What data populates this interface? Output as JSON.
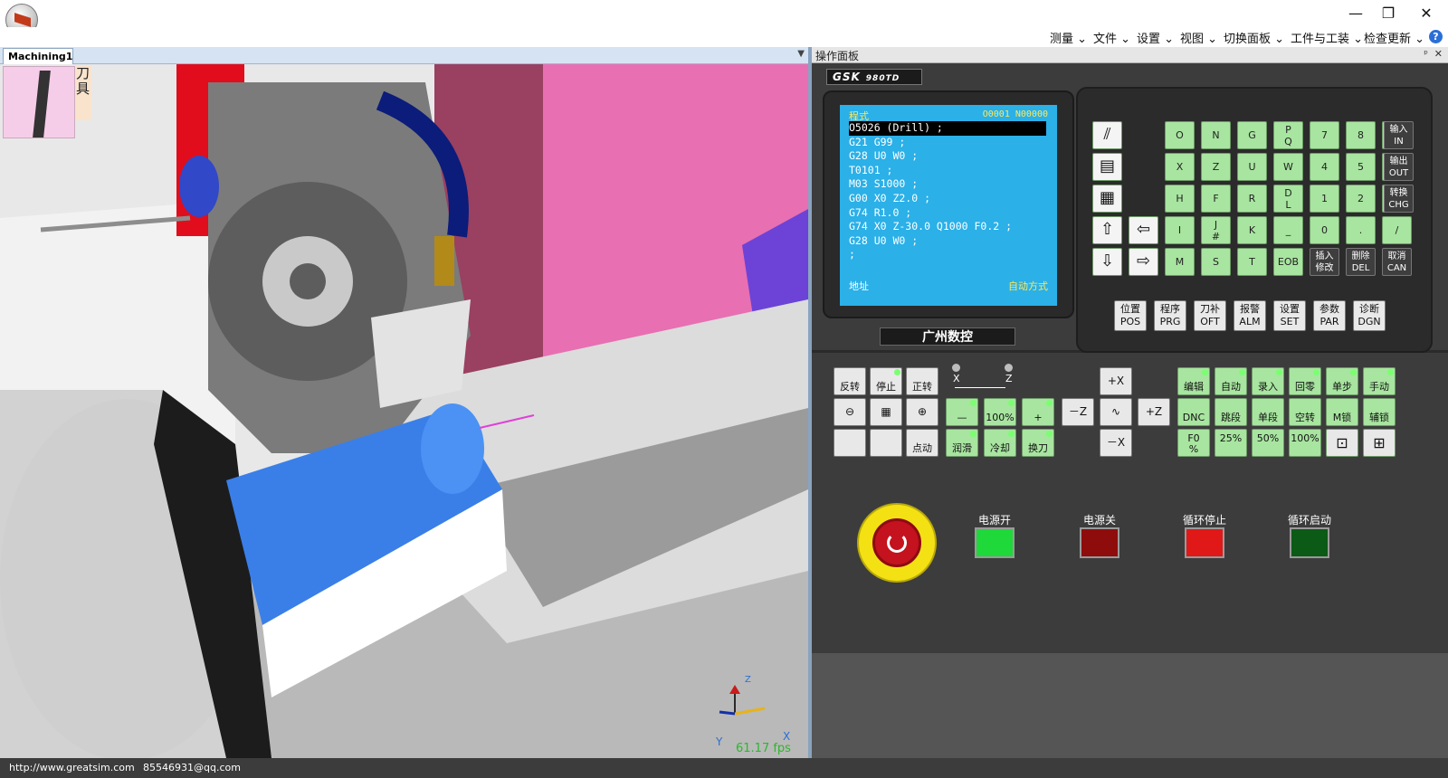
{
  "window": {
    "controls": [
      "—",
      "❐",
      "✕"
    ]
  },
  "menu": [
    "测量",
    "文件",
    "设置",
    "视图",
    "切换面板",
    "工件与工装",
    "检查更新"
  ],
  "viewport": {
    "tab": "Machining1",
    "tool_label": "刀具",
    "fps": "61.17 fps",
    "axes": {
      "x": "X",
      "y": "Y",
      "z": "Z"
    }
  },
  "panel": {
    "title": "操作面板",
    "pin": "ᵖ",
    "close": "✕",
    "logo": "GSK",
    "model": "980TD",
    "brand": "广州数控",
    "screen": {
      "prog_label": "程式",
      "prog_num": "O0001 N00000",
      "lines": [
        "O5026 (Drill) ;",
        "G21 G99 ;",
        "G28 U0 W0 ;",
        "T0101 ;",
        "M03 S1000 ;",
        "G00 X0 Z2.0 ;",
        "G74 R1.0 ;",
        "G74 X0 Z-30.0 Q1000 F0.2 ;",
        "G28 U0 W0 ;",
        ";"
      ],
      "addr_label": "地址",
      "mode_label": "自动方式"
    },
    "keypad": {
      "rows": [
        [
          "O",
          "N",
          "G",
          "P\nQ",
          "7",
          "8",
          "9"
        ],
        [
          "X",
          "Z",
          "U",
          "W",
          "4",
          "5",
          "6"
        ],
        [
          "H",
          "F",
          "R",
          "D\nL",
          "1",
          "2",
          "3"
        ],
        [
          "I",
          "J\n#",
          "K",
          "_",
          "0",
          ".",
          "/"
        ],
        [
          "M",
          "S",
          "T",
          "EOB",
          "插入\n修改",
          "删除\nDEL",
          "取消\nCAN"
        ]
      ],
      "side": [
        "输入\nIN",
        "输出\nOUT",
        "转换\nCHG"
      ],
      "function_keys": [
        "位置\nPOS",
        "程序\nPRG",
        "刀补\nOFT",
        "报警\nALM",
        "设置\nSET",
        "参数\nPAR",
        "诊断\nDGN"
      ]
    },
    "ops": {
      "row1_left": [
        "反转",
        "停止",
        "正转"
      ],
      "row2_left": [
        "⊖",
        "",
        "⊕"
      ],
      "row3_left": [
        "",
        "",
        "点动"
      ],
      "axis_labels": [
        "X",
        "Z"
      ],
      "mid_row2": [
        "—",
        "100%",
        "+"
      ],
      "mid_row3": [
        "润滑",
        "冷却",
        "换刀"
      ],
      "jog": [
        "+X",
        "－Z",
        "∿",
        "+Z",
        "－X"
      ],
      "mode_row1": [
        "编辑",
        "自动",
        "录入",
        "回零",
        "单步",
        "手动"
      ],
      "mode_row2": [
        "DNC",
        "跳段",
        "单段",
        "空转",
        "M锁",
        "辅锁"
      ],
      "mode_row3": [
        "F0\n%",
        "25%",
        "50%",
        "100%",
        "⊡",
        "⊞"
      ]
    },
    "power": [
      {
        "label": "电源开",
        "color": "#1fd83a"
      },
      {
        "label": "电源关",
        "color": "#8e0c0c"
      },
      {
        "label": "循环停止",
        "color": "#e01818"
      },
      {
        "label": "循环启动",
        "color": "#0b5a16"
      }
    ]
  },
  "status": {
    "url": "http://www.greatsim.com",
    "email": "85546931@qq.com"
  }
}
